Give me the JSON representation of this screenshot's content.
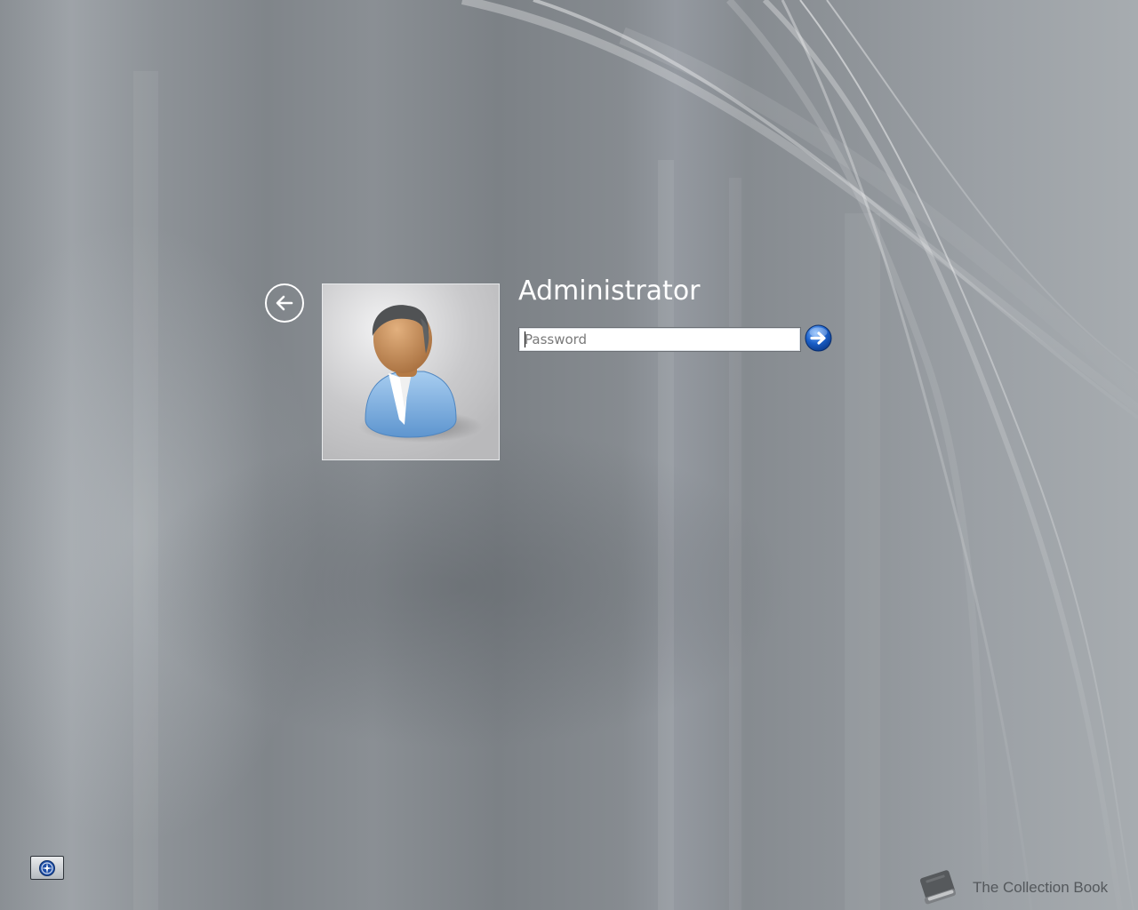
{
  "login": {
    "username": "Administrator",
    "password_placeholder": "Password",
    "password_value": ""
  },
  "icons": {
    "back": "back-arrow-icon",
    "avatar": "user-avatar-icon",
    "submit": "arrow-right-icon",
    "accessibility": "ease-of-access-icon",
    "brand": "book-icon"
  },
  "branding": {
    "text": "The Collection Book"
  },
  "colors": {
    "username_text": "#ffffff",
    "submit_blue": "#1a5fc8",
    "brand_text": "#54585c"
  }
}
